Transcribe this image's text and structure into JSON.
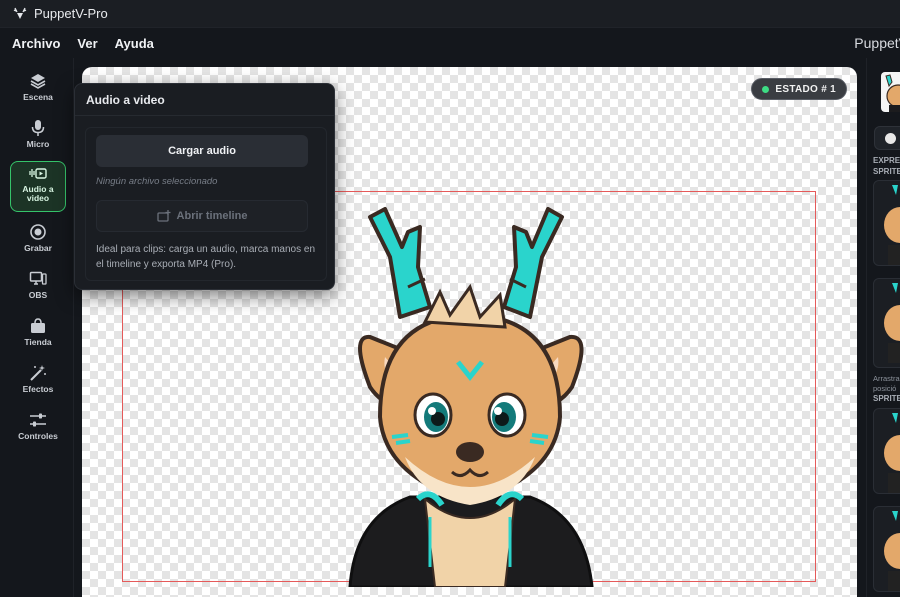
{
  "window": {
    "title": "PuppetV-Pro"
  },
  "menu": {
    "items": [
      "Archivo",
      "Ver",
      "Ayuda"
    ],
    "brand_right": "PuppetV"
  },
  "rail": {
    "items": [
      {
        "label": "Escena",
        "icon": "layers-icon"
      },
      {
        "label": "Micro",
        "icon": "microphone-icon"
      },
      {
        "label": "Audio a video",
        "icon": "audio-video-icon",
        "active": true
      },
      {
        "label": "Grabar",
        "icon": "record-icon"
      },
      {
        "label": "OBS",
        "icon": "monitor-icon"
      },
      {
        "label": "Tienda",
        "icon": "shop-bag-icon"
      },
      {
        "label": "Efectos",
        "icon": "magic-wand-icon"
      },
      {
        "label": "Controles",
        "icon": "sliders-icon"
      }
    ]
  },
  "canvas": {
    "state_badge": "ESTADO # 1",
    "state_color": "#3ddc84",
    "frame_color": "#e55a5a"
  },
  "popup": {
    "title": "Audio a video",
    "upload_button": "Cargar audio",
    "no_file": "Ningún archivo seleccionado",
    "timeline_button": "Abrir timeline",
    "hint": "Ideal para clips: carga un audio, marca manos en el timeline y exporta MP4 (Pro)."
  },
  "right_panel": {
    "label_expressions": "EXPRE",
    "label_sprites1": "SPRITE",
    "drag_hint_1": "Arrastra",
    "drag_hint_2": "posició",
    "label_sprites2": "SPRITE"
  },
  "colors": {
    "accent": "#35c46a",
    "teal": "#2ad4cc",
    "bg": "#14171c"
  }
}
